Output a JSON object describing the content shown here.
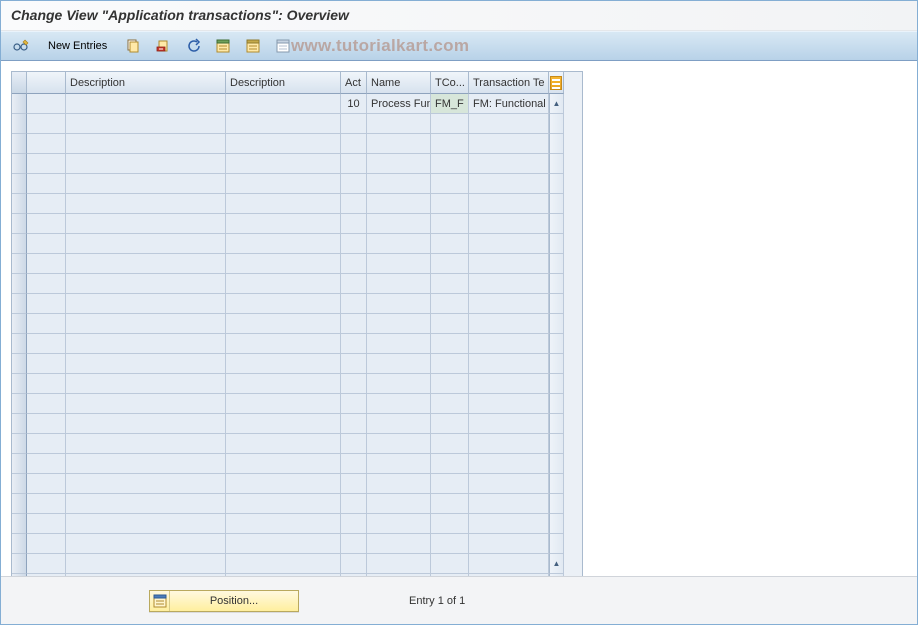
{
  "title": "Change View \"Application transactions\": Overview",
  "watermark": "www.tutorialkart.com",
  "toolbar": {
    "new_entries_label": "New Entries"
  },
  "columns": {
    "c1": "",
    "c2": "Description",
    "c3": "Description",
    "c4": "Act",
    "c5": "Name",
    "c6": "TCo...",
    "c7": "Transaction Te"
  },
  "rows": [
    {
      "c1": "",
      "c2": "",
      "c3": "",
      "c4": "10",
      "c5": "Process Fun...",
      "c6": "FM_F",
      "c7": "FM: Functional"
    }
  ],
  "empty_row_count": 24,
  "footer": {
    "position_label": "Position...",
    "entry_text": "Entry 1 of 1"
  }
}
